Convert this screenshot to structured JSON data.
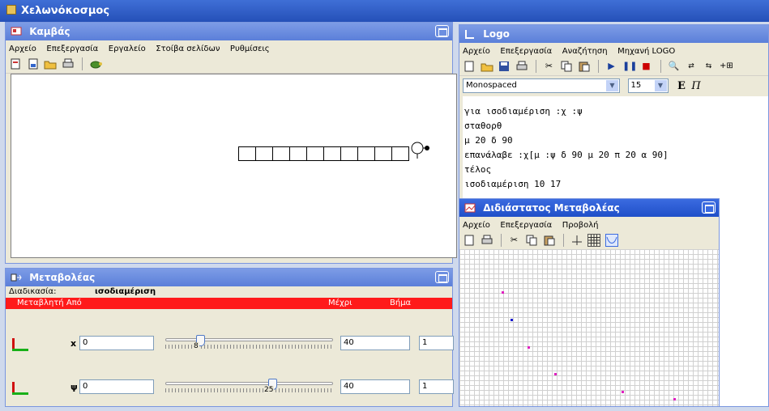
{
  "app": {
    "title": "Χελωνόκοσμος"
  },
  "canvas_window": {
    "title": "Καμβάς",
    "menu": [
      "Αρχείο",
      "Επεξεργασία",
      "Εργαλείο",
      "Στοίβα σελίδων",
      "Ρυθμίσεις"
    ]
  },
  "logo_window": {
    "title": "Logo",
    "menu": [
      "Αρχείο",
      "Επεξεργασία",
      "Αναζήτηση",
      "Μηχανή LOGO"
    ],
    "font_name": "Monospaced",
    "font_size": "15",
    "bold_label": "E",
    "italic_label": "Π",
    "code_lines": [
      "για  ισοδιαμέριση :χ :ψ",
      "σταθορθ",
      "μ 20 δ 90",
      "επανάλαβε :χ[μ :ψ δ 90 μ 20 π 20 α 90]",
      "τέλος",
      "ισοδιαμέριση  10 17"
    ]
  },
  "variables_window": {
    "title": "Μεταβολέας",
    "procedure_label": "Διαδικασία:",
    "procedure_name": "ισοδιαμέριση",
    "headers": {
      "variable_from": "Μεταβλητή Από",
      "to": "Μέχρι",
      "step": "Βήμα"
    },
    "rows": [
      {
        "name": "x",
        "from": "0",
        "slider_value": "8",
        "slider_fraction": 0.2,
        "to": "40",
        "step": "1"
      },
      {
        "name": "ψ",
        "from": "0",
        "slider_value": "25",
        "slider_fraction": 0.62,
        "to": "40",
        "step": "1"
      }
    ]
  },
  "plot_window": {
    "title": "Διδιάστατος Μεταβολέας",
    "menu": [
      "Αρχείο",
      "Επεξεργασία",
      "Προβολή"
    ]
  },
  "colors": {
    "accent": "#1f4fc8",
    "header_red": "#ff1a1a",
    "point_magenta": "#e020c0",
    "point_blue": "#1a1ad0"
  }
}
